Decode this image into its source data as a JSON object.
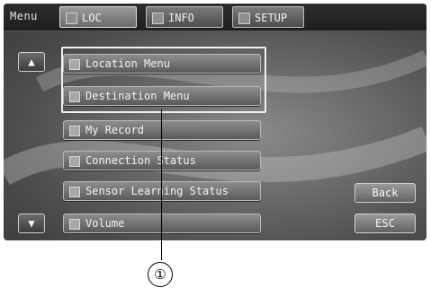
{
  "header": {
    "menu_label": "Menu",
    "tabs": [
      {
        "label": "LOC",
        "active": true
      },
      {
        "label": "INFO",
        "active": false
      },
      {
        "label": "SETUP",
        "active": false
      }
    ]
  },
  "list": {
    "items": [
      "Location Menu",
      "Destination Menu",
      "My Record",
      "Connection Status",
      "Sensor Learning Status",
      "Volume"
    ],
    "scroll_up_icon": "chevron-up-icon",
    "scroll_down_icon": "chevron-down-icon"
  },
  "side_buttons": {
    "back": "Back",
    "esc": "ESC"
  },
  "callout": {
    "label": "①"
  },
  "colors": {
    "screen_background": "#5a5a5a",
    "button_face": "#7a7a7a",
    "highlight_frame": "#f0f0f0"
  }
}
